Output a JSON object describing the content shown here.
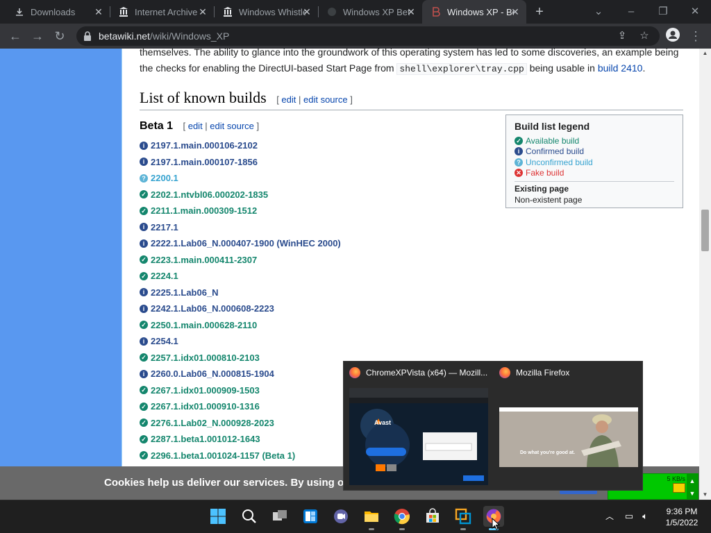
{
  "browser": {
    "tabs": [
      {
        "title": "Downloads",
        "icon": "download-icon"
      },
      {
        "title": "Internet Archive",
        "icon": "archive-icon"
      },
      {
        "title": "Windows Whistler",
        "icon": "archive-icon"
      },
      {
        "title": "Windows XP Beta",
        "icon": "page-icon"
      },
      {
        "title": "Windows XP - BetaWiki",
        "icon": "betawiki-icon",
        "active": true
      }
    ],
    "url_domain": "betawiki.net",
    "url_path": "/wiki/Windows_XP"
  },
  "page": {
    "intro_line1": "themselves. The ability to glance into the groundwork of this operating system has led to some discoveries, an example being",
    "intro_line2_a": "the checks for enabling the DirectUI-based Start Page from ",
    "intro_code": "shell\\explorer\\tray.cpp",
    "intro_line2_b": " being usable in ",
    "intro_link": "build 2410",
    "intro_end": ".",
    "section_title": "List of known builds",
    "subsection_title": "Beta 1",
    "edit_label": "edit",
    "edit_source_label": "edit source",
    "builds": [
      {
        "label": "2197.1.main.000106-2102",
        "status": "confirmed"
      },
      {
        "label": "2197.1.main.000107-1856",
        "status": "confirmed"
      },
      {
        "label": "2200.1",
        "status": "unconfirmed"
      },
      {
        "label": "2202.1.ntvbl06.000202-1835",
        "status": "available"
      },
      {
        "label": "2211.1.main.000309-1512",
        "status": "available"
      },
      {
        "label": "2217.1",
        "status": "confirmed"
      },
      {
        "label": "2222.1.Lab06_N.000407-1900 (WinHEC 2000)",
        "status": "confirmed"
      },
      {
        "label": "2223.1.main.000411-2307",
        "status": "available"
      },
      {
        "label": "2224.1",
        "status": "available"
      },
      {
        "label": "2225.1.Lab06_N",
        "status": "confirmed"
      },
      {
        "label": "2242.1.Lab06_N.000608-2223",
        "status": "confirmed"
      },
      {
        "label": "2250.1.main.000628-2110",
        "status": "available"
      },
      {
        "label": "2254.1",
        "status": "confirmed"
      },
      {
        "label": "2257.1.idx01.000810-2103",
        "status": "available"
      },
      {
        "label": "2260.0.Lab06_N.000815-1904",
        "status": "confirmed"
      },
      {
        "label": "2267.1.idx01.000909-1503",
        "status": "available"
      },
      {
        "label": "2267.1.idx01.000910-1316",
        "status": "available"
      },
      {
        "label": "2276.1.Lab02_N.000928-2023",
        "status": "available"
      },
      {
        "label": "2287.1.beta1.001012-1643",
        "status": "available"
      },
      {
        "label": "2296.1.beta1.001024-1157 (Beta 1)",
        "status": "available"
      }
    ],
    "legend": {
      "title": "Build list legend",
      "items": [
        {
          "label": "Available build",
          "status": "available"
        },
        {
          "label": "Confirmed build",
          "status": "confirmed"
        },
        {
          "label": "Unconfirmed build",
          "status": "unconfirmed"
        },
        {
          "label": "Fake build",
          "status": "fake"
        }
      ],
      "existing": "Existing page",
      "nonexistent": "Non-existent page"
    },
    "cookie_text": "Cookies help us deliver our services. By using ou"
  },
  "net_widget": {
    "speed": "5 KB/s"
  },
  "thumbnails": [
    {
      "title": "ChromeXPVista (x64) — Mozill...",
      "preview_heading": "Avast"
    },
    {
      "title": "Mozilla Firefox",
      "preview_caption": "Do what you're good at."
    }
  ],
  "taskbar": {
    "apps": [
      "start",
      "search",
      "task-view",
      "widgets",
      "teams-chat",
      "file-explorer",
      "chrome",
      "store",
      "vmware",
      "firefox"
    ]
  },
  "clock": {
    "time": "9:36 PM",
    "date": "1/5/2022"
  },
  "colors": {
    "available": "#14866d",
    "confirmed": "#2a4b8d",
    "unconfirmed": "#36a3d0",
    "fake": "#dd3333",
    "link": "#0645ad",
    "sidebar_blue": "#5998f0"
  }
}
